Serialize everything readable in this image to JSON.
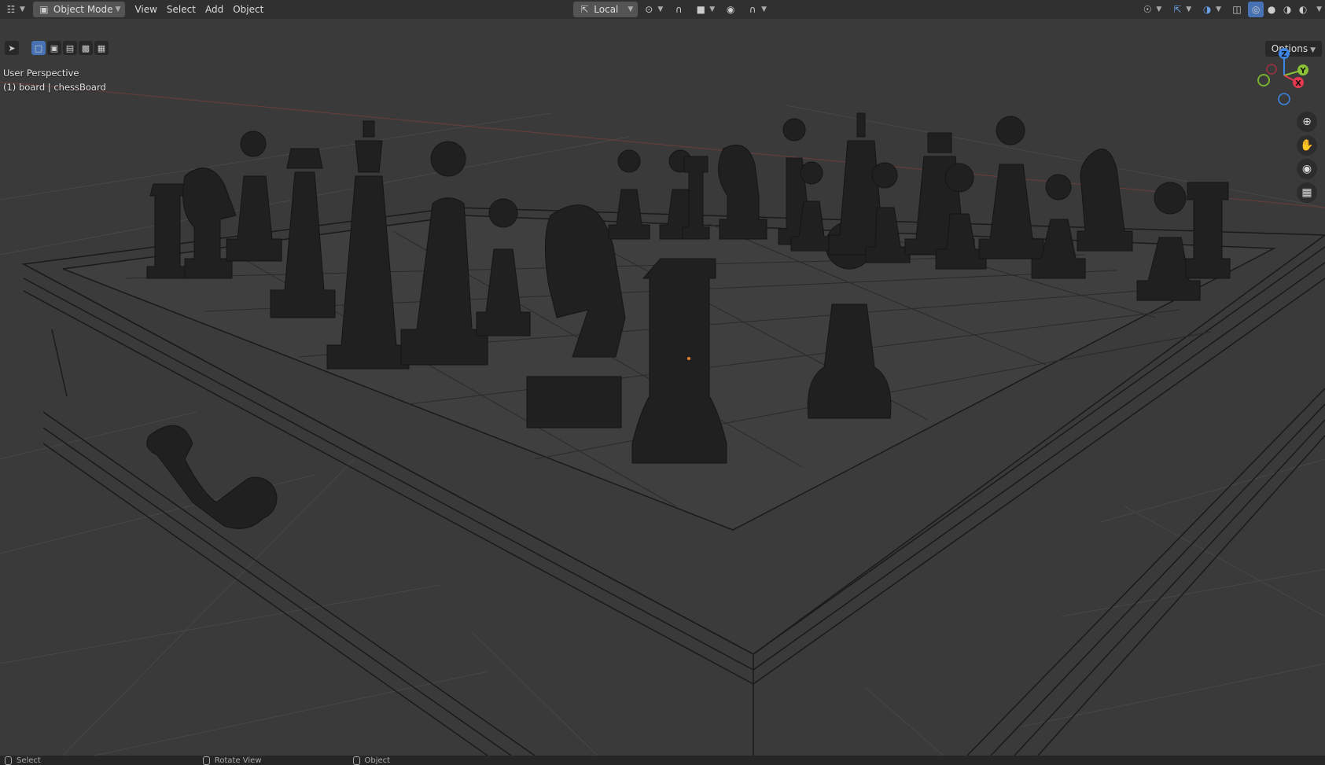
{
  "header": {
    "editor_icon": "3d-viewport-icon",
    "mode_label": "Object Mode",
    "menus": [
      "View",
      "Select",
      "Add",
      "Object"
    ],
    "transform_orientation": "Local"
  },
  "toolbar": {
    "options_label": "Options"
  },
  "viewport": {
    "perspective_label": "User Perspective",
    "object_label": "(1) board | chessBoard"
  },
  "gizmo": {
    "z": "Z",
    "y": "Y",
    "x": "X"
  },
  "status": {
    "select": "Select",
    "rotate": "Rotate View",
    "object": "Object"
  },
  "colors": {
    "header_bg": "#303030",
    "viewport_bg": "#3a3a3a",
    "active_blue": "#4772b3",
    "axis_x": "#e53950",
    "axis_y": "#8bc136",
    "axis_z": "#3c87e6"
  }
}
